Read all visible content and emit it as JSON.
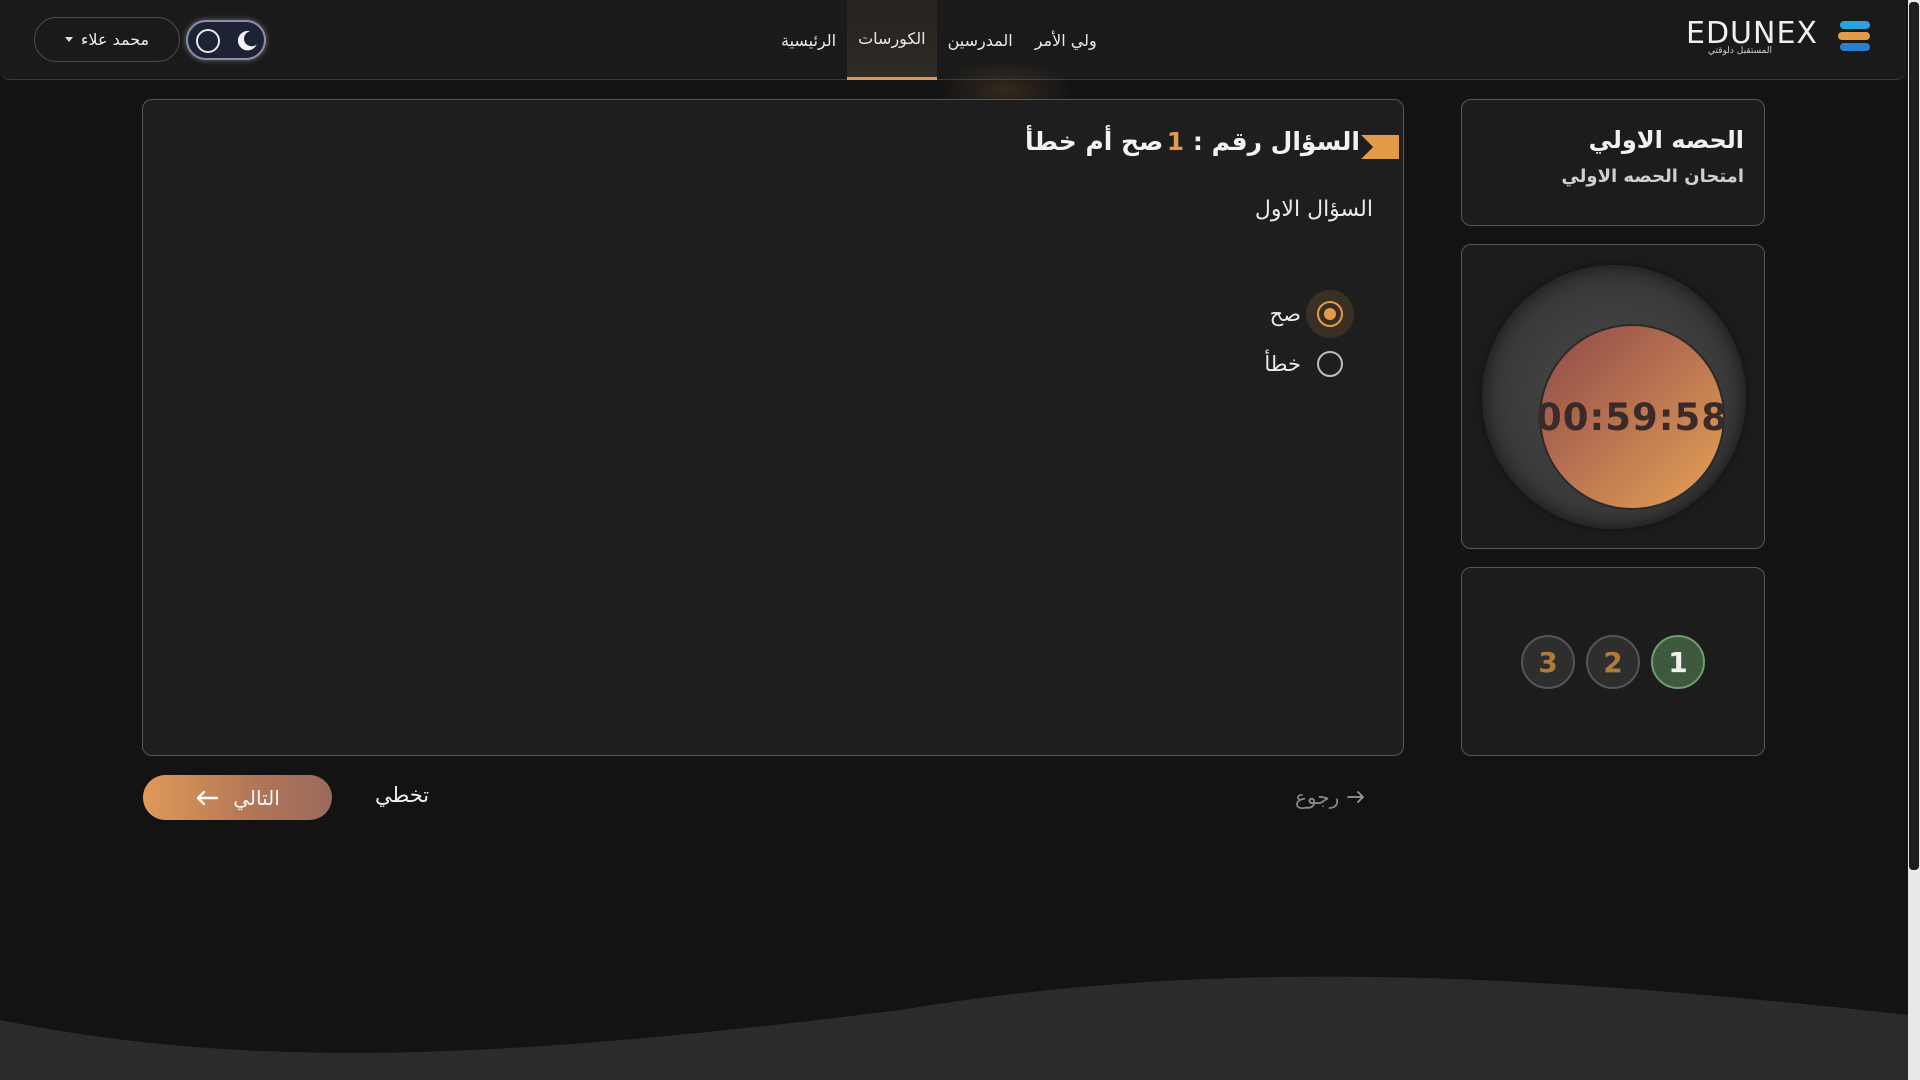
{
  "header": {
    "user_name": "محمد علاء",
    "nav": [
      {
        "label": "الرئيسية",
        "active": false
      },
      {
        "label": "الكورسات",
        "active": true
      },
      {
        "label": "المدرسين",
        "active": false
      },
      {
        "label": "ولي الأمر",
        "active": false
      }
    ],
    "logo": {
      "text": "EDUNEX",
      "tagline": "المستقبل دلوقتي"
    }
  },
  "sidebar": {
    "lesson_title": "الحصه الاولي",
    "exam_title": "امتحان الحصه الاولي",
    "timer": "00:59:58",
    "question_numbers": [
      "1",
      "2",
      "3"
    ],
    "current_question": 1
  },
  "question": {
    "number_label": "السؤال رقم :",
    "number": "1",
    "type": "صح أم خطأ",
    "text": "السؤال الاول",
    "options": [
      {
        "label": "صح",
        "selected": true
      },
      {
        "label": "خطأ",
        "selected": false
      }
    ]
  },
  "controls": {
    "next_label": "التالي",
    "skip_label": "تخطي",
    "back_label": "رجوع"
  },
  "colors": {
    "accent": "#e39b4a",
    "background": "#131313",
    "card": "#1e1e1e",
    "current_question": "#3d5a3e"
  }
}
